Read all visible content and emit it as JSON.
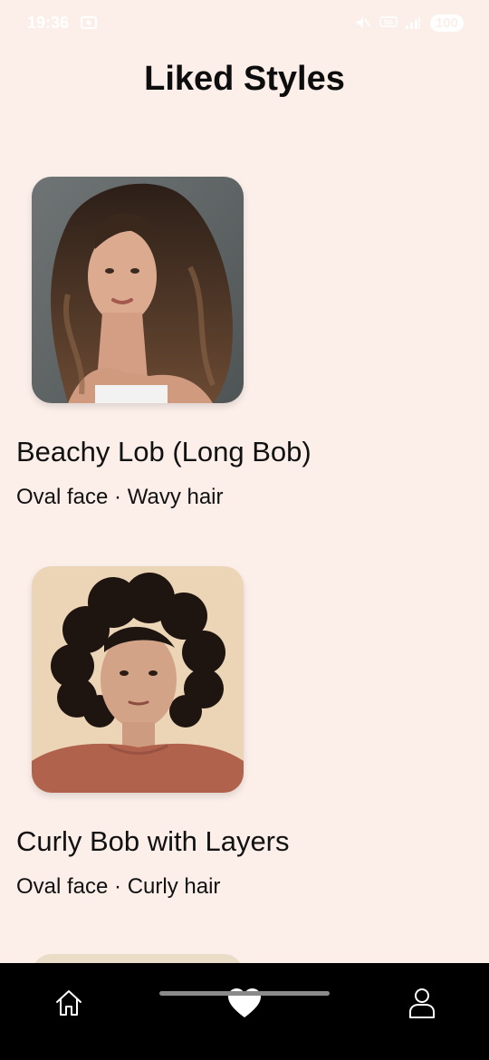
{
  "status_bar": {
    "time": "19:36",
    "battery": "100",
    "icons": [
      "screenshot-icon",
      "mute-icon",
      "network-icon",
      "signal-icon"
    ]
  },
  "header": {
    "title": "Liked Styles"
  },
  "styles": [
    {
      "title": "Beachy Lob (Long Bob)",
      "subtitle": "Oval face · Wavy hair",
      "image_icon": "wavy-hair-portrait"
    },
    {
      "title": "Curly Bob with Layers",
      "subtitle": "Oval face · Curly hair",
      "image_icon": "curly-hair-portrait"
    }
  ],
  "bottom_nav": {
    "items": [
      {
        "icon": "home-icon",
        "active": false
      },
      {
        "icon": "heart-icon",
        "active": true
      },
      {
        "icon": "profile-icon",
        "active": false
      }
    ]
  },
  "colors": {
    "background": "#fcefea",
    "nav_background": "#000000",
    "nav_icon": "#ffffff"
  }
}
